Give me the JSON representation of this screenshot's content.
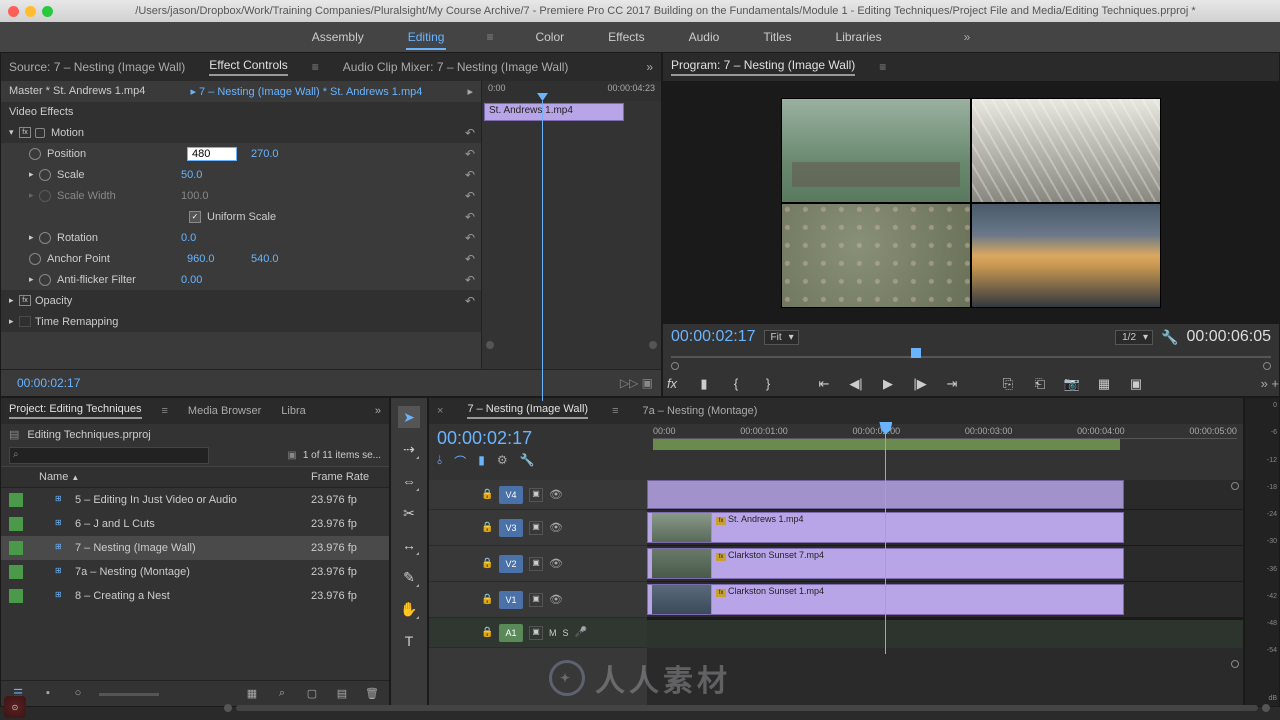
{
  "titlebar": "/Users/jason/Dropbox/Work/Training Companies/Pluralsight/My Course Archive/7 - Premiere Pro CC 2017 Building on the Fundamentals/Module 1 - Editing Techniques/Project File and Media/Editing Techniques.prproj *",
  "workspaces": {
    "items": [
      "Assembly",
      "Editing",
      "Color",
      "Effects",
      "Audio",
      "Titles",
      "Libraries"
    ],
    "active": "Editing"
  },
  "source": {
    "tabs": {
      "source": "Source: 7 – Nesting (Image Wall)",
      "ec": "Effect Controls",
      "mixer": "Audio Clip Mixer: 7 – Nesting (Image Wall)"
    },
    "master": "Master * St. Andrews 1.mp4",
    "breadcrumb": "7 – Nesting (Image Wall) * St. Andrews 1.mp4",
    "video_effects": "Video Effects",
    "motion": "Motion",
    "position": {
      "label": "Position",
      "x": "480",
      "y": "270.0"
    },
    "scale": {
      "label": "Scale",
      "val": "50.0"
    },
    "scale_width": {
      "label": "Scale Width",
      "val": "100.0"
    },
    "uniform": "Uniform Scale",
    "rotation": {
      "label": "Rotation",
      "val": "0.0"
    },
    "anchor": {
      "label": "Anchor Point",
      "x": "960.0",
      "y": "540.0"
    },
    "flicker": {
      "label": "Anti-flicker Filter",
      "val": "0.00"
    },
    "opacity": "Opacity",
    "timeremap": "Time Remapping",
    "ruler": {
      "start": "0:00",
      "end": "00:00:04:23"
    },
    "clip": "St. Andrews 1.mp4",
    "tc": "00:00:02:17"
  },
  "program": {
    "tab": "Program: 7 – Nesting (Image Wall)",
    "tc_left": "00:00:02:17",
    "fit": "Fit",
    "zoom": "1/2",
    "tc_right": "00:00:06:05"
  },
  "project": {
    "tabs": [
      "Project: Editing Techniques",
      "Media Browser",
      "Libra"
    ],
    "file": "Editing Techniques.prproj",
    "items_text": "1 of 11 items se...",
    "cols": {
      "name": "Name",
      "fps": "Frame Rate"
    },
    "rows": [
      {
        "name": "5 – Editing In Just Video or Audio",
        "fps": "23.976 fp"
      },
      {
        "name": "6 – J and L Cuts",
        "fps": "23.976 fp"
      },
      {
        "name": "7 – Nesting (Image Wall)",
        "fps": "23.976 fp",
        "sel": true
      },
      {
        "name": "7a – Nesting (Montage)",
        "fps": "23.976 fp"
      },
      {
        "name": "8 – Creating a Nest",
        "fps": "23.976 fp"
      }
    ],
    "search_placeholder": ""
  },
  "timeline": {
    "tabs": {
      "active": "7 – Nesting (Image Wall)",
      "other": "7a – Nesting (Montage)"
    },
    "tc": "00:00:02:17",
    "ruler": [
      "00:00",
      "00:00:01:00",
      "00:00:02:00",
      "00:00:03:00",
      "00:00:04:00",
      "00:00:05:00"
    ],
    "tracks": {
      "V4": "V4",
      "V3": "V3",
      "V2": "V2",
      "V1": "V1",
      "A1": "A1"
    },
    "clips": {
      "v3": "St. Andrews 1.mp4",
      "v2": "Clarkston Sunset 7.mp4",
      "v1": "Clarkston Sunset 1.mp4"
    },
    "audio_labels": {
      "m": "M",
      "s": "S"
    }
  },
  "meter": [
    "0",
    "-6",
    "-12",
    "-18",
    "-24",
    "-30",
    "-36",
    "-42",
    "-48",
    "-54",
    "",
    "dB"
  ]
}
